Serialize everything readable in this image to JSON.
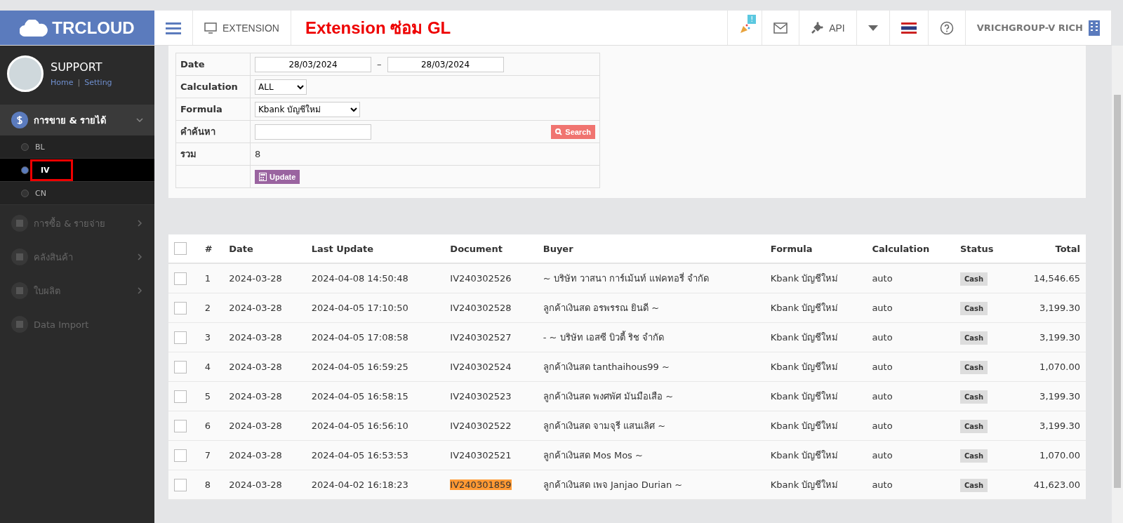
{
  "header": {
    "logo": "TRCLOUD",
    "menu_button": "EXTENSION",
    "page_title": "Extension ซ่อม GL",
    "notification_badge": "!",
    "api_label": "API",
    "company": "VRICHGROUP-V RICH"
  },
  "sidebar": {
    "user": {
      "name": "SUPPORT",
      "links": [
        "Home",
        "Setting"
      ],
      "link_separator": "|"
    },
    "items": [
      {
        "label": "การขาย & รายได้",
        "expanded": true,
        "disabled": false,
        "children": [
          {
            "label": "BL",
            "selected": false,
            "annotated": false
          },
          {
            "label": "IV",
            "selected": true,
            "annotated": true
          },
          {
            "label": "CN",
            "selected": false,
            "annotated": false
          }
        ]
      },
      {
        "label": "การซื้อ & รายจ่าย",
        "expanded": false,
        "disabled": true
      },
      {
        "label": "คลังสินค้า",
        "expanded": false,
        "disabled": true
      },
      {
        "label": "ใบผลิต",
        "expanded": false,
        "disabled": true
      },
      {
        "label": "Data Import",
        "expanded": false,
        "disabled": true
      }
    ]
  },
  "filter": {
    "date_label": "Date",
    "date_from": "28/03/2024",
    "date_sep": "–",
    "date_to": "28/03/2024",
    "calculation_label": "Calculation",
    "calculation": "ALL",
    "formula_label": "Formula",
    "formula": "Kbank บัญชีใหม่",
    "search_label": "คำค้นหา",
    "search_button": "Search",
    "total_label": "รวม",
    "total": "8",
    "update_button": "Update"
  },
  "table": {
    "all_checked": false,
    "columns": [
      "#",
      "Date",
      "Last Update",
      "Document",
      "Buyer",
      "Formula",
      "Calculation",
      "Status",
      "Total"
    ],
    "rows": [
      {
        "no": "1",
        "date": "2024-03-28",
        "last_update": "2024-04-08 14:50:48",
        "document": "IV240302526",
        "buyer": "~ บริษัท วาสนา การ์เม้นท์ แฟคทอรี่ จำกัด",
        "formula": "Kbank บัญชีใหม่",
        "calculation": "auto",
        "status": "Cash",
        "total": "14,546.65",
        "highlighted": false,
        "checked": false
      },
      {
        "no": "2",
        "date": "2024-03-28",
        "last_update": "2024-04-05 17:10:50",
        "document": "IV240302528",
        "buyer": "ลูกค้าเงินสด อรพรรณ ยินดี ~",
        "formula": "Kbank บัญชีใหม่",
        "calculation": "auto",
        "status": "Cash",
        "total": "3,199.30",
        "highlighted": false,
        "checked": false
      },
      {
        "no": "3",
        "date": "2024-03-28",
        "last_update": "2024-04-05 17:08:58",
        "document": "IV240302527",
        "buyer": "- ~ บริษัท เอสซี บิวตี้ ริช จำกัด",
        "formula": "Kbank บัญชีใหม่",
        "calculation": "auto",
        "status": "Cash",
        "total": "3,199.30",
        "highlighted": false,
        "checked": false
      },
      {
        "no": "4",
        "date": "2024-03-28",
        "last_update": "2024-04-05 16:59:25",
        "document": "IV240302524",
        "buyer": "ลูกค้าเงินสด tanthaihous99 ~",
        "formula": "Kbank บัญชีใหม่",
        "calculation": "auto",
        "status": "Cash",
        "total": "1,070.00",
        "highlighted": false,
        "checked": false
      },
      {
        "no": "5",
        "date": "2024-03-28",
        "last_update": "2024-04-05 16:58:15",
        "document": "IV240302523",
        "buyer": "ลูกค้าเงินสด พงศพัศ มันมือเสือ ~",
        "formula": "Kbank บัญชีใหม่",
        "calculation": "auto",
        "status": "Cash",
        "total": "3,199.30",
        "highlighted": false,
        "checked": false
      },
      {
        "no": "6",
        "date": "2024-03-28",
        "last_update": "2024-04-05 16:56:10",
        "document": "IV240302522",
        "buyer": "ลูกค้าเงินสด จามจุรี แสนเลิศ ~",
        "formula": "Kbank บัญชีใหม่",
        "calculation": "auto",
        "status": "Cash",
        "total": "3,199.30",
        "highlighted": false,
        "checked": false
      },
      {
        "no": "7",
        "date": "2024-03-28",
        "last_update": "2024-04-05 16:53:53",
        "document": "IV240302521",
        "buyer": "ลูกค้าเงินสด Mos Mos ~",
        "formula": "Kbank บัญชีใหม่",
        "calculation": "auto",
        "status": "Cash",
        "total": "1,070.00",
        "highlighted": false,
        "checked": false
      },
      {
        "no": "8",
        "date": "2024-03-28",
        "last_update": "2024-04-02 16:18:23",
        "document": "IV240301859",
        "buyer": "ลูกค้าเงินสด เพจ Janjao Durian ~",
        "formula": "Kbank บัญชีใหม่",
        "calculation": "auto",
        "status": "Cash",
        "total": "41,623.00",
        "highlighted": true,
        "checked": false
      }
    ]
  }
}
